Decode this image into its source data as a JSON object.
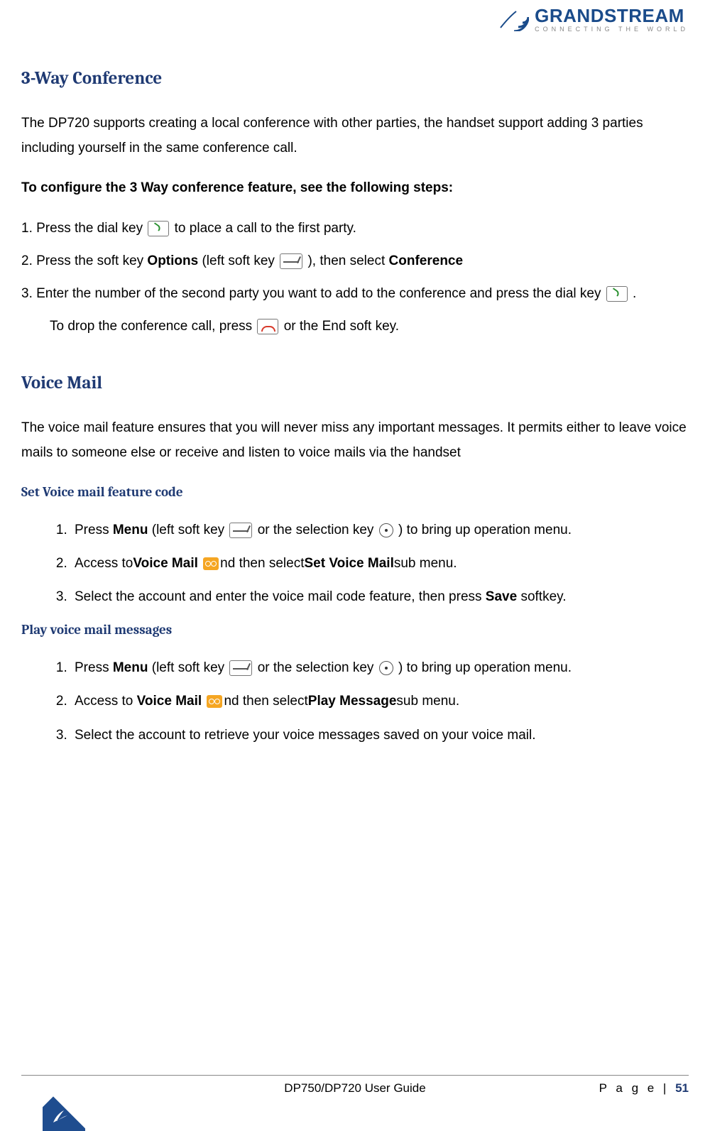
{
  "header": {
    "brand": "GRANDSTREAM",
    "tagline": "CONNECTING THE WORLD"
  },
  "sections": {
    "conf_title": "3-Way Conference",
    "conf_intro": "The DP720 supports creating a local conference with other parties, the handset support adding 3 parties including yourself in the same conference call.",
    "conf_config_heading": "To configure the 3 Way conference feature, see the following steps:",
    "conf_step1_a": "1. Press the dial key ",
    "conf_step1_b": " to place a call to the first party.",
    "conf_step2_a": "2. Press the soft key ",
    "conf_step2_opt": "Options",
    "conf_step2_b": " (left soft key ",
    "conf_step2_c": " ), then select ",
    "conf_step2_conf": "Conference",
    "conf_step3_a": "3. Enter the number of the second party you want to add to the conference and press the dial key",
    "conf_step3_b": " .",
    "conf_step3_drop_a": "To drop the conference call, press  ",
    "conf_step3_drop_b": "  or the End soft key.",
    "vm_title": "Voice Mail",
    "vm_intro": "The voice mail feature ensures that you will never miss any important messages. It permits either to leave voice mails to someone else or receive and listen to voice mails via the handset",
    "vm_set_heading": "Set Voice mail feature code",
    "vm_set_1_a": "Press ",
    "vm_set_1_menu": "Menu",
    "vm_set_1_b": " (left soft key ",
    "vm_set_1_c": " or the selection key",
    "vm_set_1_d": " ) to bring up operation menu.",
    "vm_set_2_a": "Access to",
    "vm_set_2_vm": "Voice Mail",
    "vm_set_2_b": "nd then select",
    "vm_set_2_svm": "Set Voice Mail",
    "vm_set_2_c": "sub menu.",
    "vm_set_3_a": "Select the account and enter the voice mail code feature, then press ",
    "vm_set_3_save": "Save",
    "vm_set_3_b": " softkey.",
    "vm_play_heading": "Play voice mail messages",
    "vm_play_1_a": "Press ",
    "vm_play_1_menu": "Menu",
    "vm_play_1_b": " (left soft key ",
    "vm_play_1_c": " or the selection key",
    "vm_play_1_d": " ) to bring up operation menu.",
    "vm_play_2_a": "Access to ",
    "vm_play_2_vm": "Voice Mail",
    "vm_play_2_b": "nd then select",
    "vm_play_2_pm": "Play Message",
    "vm_play_2_c": "sub menu.",
    "vm_play_3": "Select the account to retrieve your voice messages saved on your voice mail."
  },
  "footer": {
    "center": "DP750/DP720 User Guide",
    "page_label": "P a g e | ",
    "page_num": "51"
  }
}
